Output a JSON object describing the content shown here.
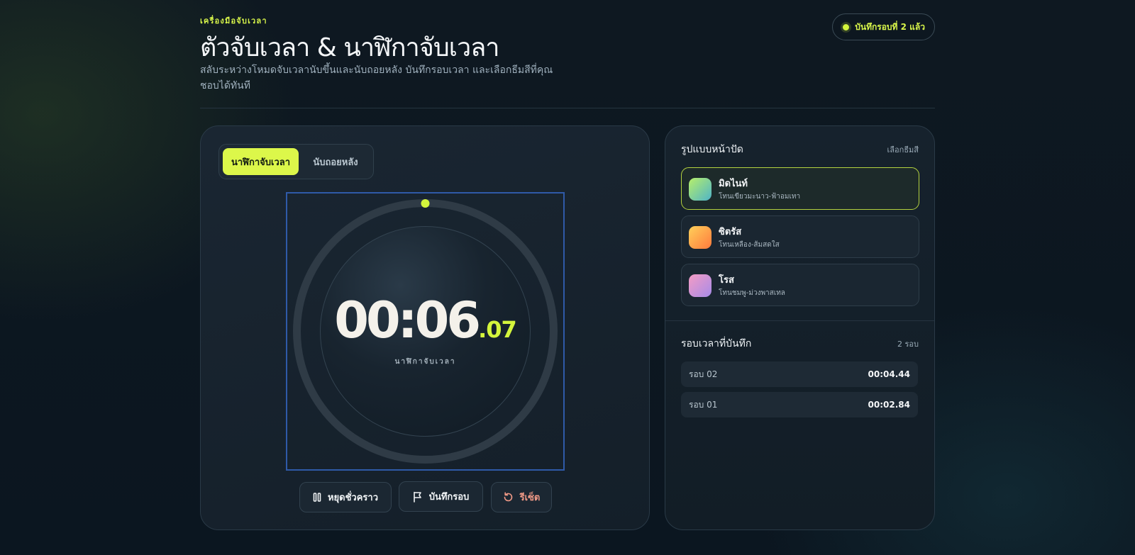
{
  "header": {
    "eyebrow": "เครื่องมือจับเวลา",
    "title": "ตัวจับเวลา & นาฬิกาจับเวลา",
    "subtitle": "สลับระหว่างโหมดจับเวลานับขึ้นและนับถอยหลัง บันทึกรอบเวลา และเลือกธีมสีที่คุณชอบได้ทันที",
    "lap_badge": "บันทึกรอบที่ 2 แล้ว"
  },
  "modes": {
    "stopwatch": "นาฬิกาจับเวลา",
    "countdown": "นับถอยหลัง",
    "active": "stopwatch"
  },
  "display": {
    "time": "00:06",
    "ms": ".07",
    "label": "นาฬิกาจับเวลา"
  },
  "controls": {
    "pause": "หยุดชั่วคราว",
    "lap": "บันทึกรอบ",
    "reset": "รีเซ็ต"
  },
  "themes": {
    "title": "รูปแบบหน้าปัด",
    "hint": "เลือกธีมสี",
    "items": [
      {
        "name": "มิดไนท์",
        "desc": "โทนเขียวมะนาว-ฟ้าอมเทา",
        "selected": true
      },
      {
        "name": "ซิตรัส",
        "desc": "โทนเหลือง-ส้มสดใส",
        "selected": false
      },
      {
        "name": "โรส",
        "desc": "โทนชมพู-ม่วงพาสเทล",
        "selected": false
      }
    ]
  },
  "laps": {
    "title": "รอบเวลาที่บันทึก",
    "count": "2 รอบ",
    "items": [
      {
        "name": "รอบ 02",
        "time": "00:04.44"
      },
      {
        "name": "รอบ 01",
        "time": "00:02.84"
      }
    ]
  },
  "colors": {
    "accent": "#dcf74a",
    "reset": "#f19a87",
    "frame": "#2f5aa8"
  }
}
